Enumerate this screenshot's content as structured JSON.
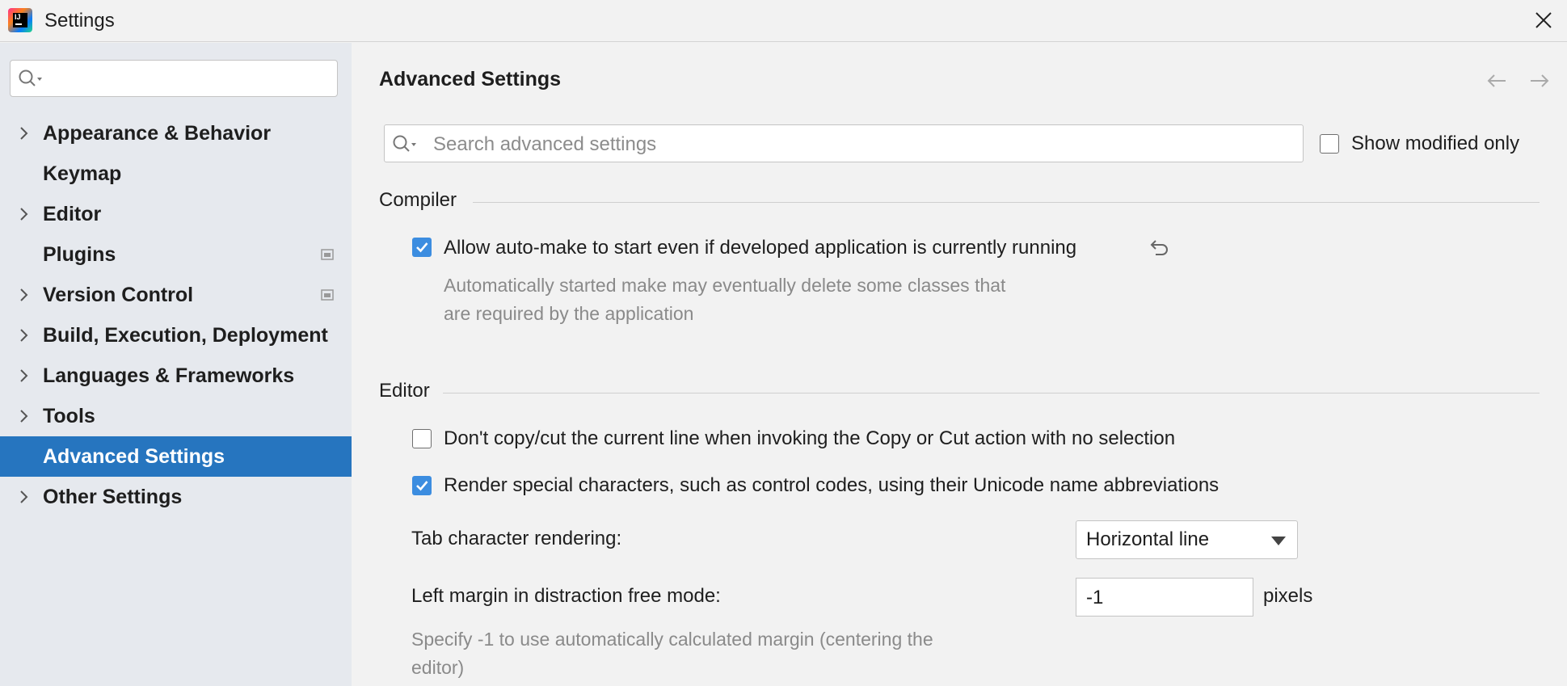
{
  "window": {
    "title": "Settings",
    "logo_text": "IJ"
  },
  "sidebar": {
    "search": {
      "value": "",
      "placeholder": ""
    },
    "items": [
      {
        "label": "Appearance & Behavior",
        "expandable": true
      },
      {
        "label": "Keymap",
        "expandable": false
      },
      {
        "label": "Editor",
        "expandable": true
      },
      {
        "label": "Plugins",
        "expandable": false,
        "project_icon": true
      },
      {
        "label": "Version Control",
        "expandable": true,
        "project_icon": true
      },
      {
        "label": "Build, Execution, Deployment",
        "expandable": true
      },
      {
        "label": "Languages & Frameworks",
        "expandable": true
      },
      {
        "label": "Tools",
        "expandable": true
      },
      {
        "label": "Advanced Settings",
        "expandable": false,
        "selected": true
      },
      {
        "label": "Other Settings",
        "expandable": true
      }
    ]
  },
  "main": {
    "title": "Advanced Settings",
    "search": {
      "placeholder": "Search advanced settings",
      "value": ""
    },
    "show_modified": {
      "label": "Show modified only",
      "checked": false
    },
    "sections": {
      "compiler": {
        "title": "Compiler",
        "auto_make": {
          "label": "Allow auto-make to start even if developed application is currently running",
          "checked": true,
          "hint_line1": "Automatically started make may eventually delete some classes that",
          "hint_line2": "are required by the application"
        }
      },
      "editor": {
        "title": "Editor",
        "dont_copy": {
          "label": "Don't copy/cut the current line when invoking the Copy or Cut action with no selection",
          "checked": false
        },
        "render_special": {
          "label": "Render special characters, such as control codes, using their Unicode name abbreviations",
          "checked": true
        },
        "tab_rendering": {
          "label": "Tab character rendering:",
          "value": "Horizontal line"
        },
        "left_margin": {
          "label": "Left margin in distraction free mode:",
          "value": "-1",
          "unit": "pixels",
          "hint_line1": "Specify -1 to use automatically calculated margin (centering the",
          "hint_line2": "editor)"
        }
      }
    }
  },
  "colors": {
    "accent": "#2675bf",
    "checkbox": "#3c8de0",
    "sidebar_bg": "#e6e9ee",
    "panel_bg": "#f2f2f2"
  },
  "icons": [
    "app-logo",
    "close-icon",
    "search-icon",
    "chevron-right-icon",
    "project-level-icon",
    "back-arrow-icon",
    "forward-arrow-icon",
    "reset-icon",
    "dropdown-arrow-icon",
    "checkmark-icon"
  ]
}
